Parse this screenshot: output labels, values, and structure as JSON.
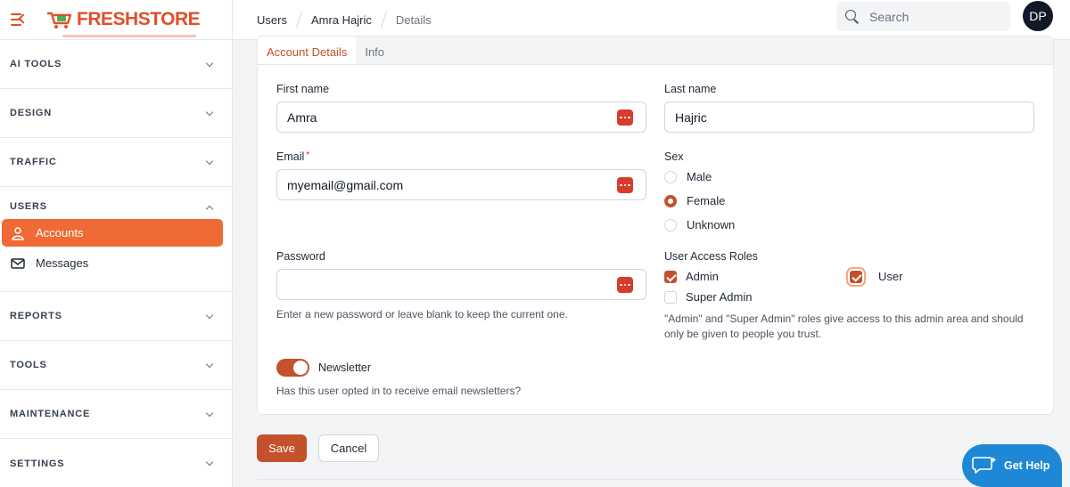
{
  "brand": {
    "name_part1": "FRESH",
    "name_part2": "STORE",
    "color": "#e0502a"
  },
  "sidebar": {
    "sections_top": [
      {
        "label": "AI TOOLS"
      },
      {
        "label": "DESIGN"
      },
      {
        "label": "TRAFFIC"
      }
    ],
    "users": {
      "label": "USERS",
      "items": [
        {
          "label": "Accounts",
          "icon": "users-icon",
          "active": true
        },
        {
          "label": "Messages",
          "icon": "envelope-icon",
          "active": false
        }
      ]
    },
    "sections_bottom": [
      {
        "label": "REPORTS"
      },
      {
        "label": "TOOLS"
      },
      {
        "label": "MAINTENANCE"
      },
      {
        "label": "SETTINGS"
      }
    ]
  },
  "breadcrumb": [
    "Users",
    "Amra Hajric",
    "Details"
  ],
  "search": {
    "placeholder": "Search"
  },
  "avatar": {
    "initials": "DP"
  },
  "tabs": [
    {
      "label": "Account Details",
      "active": true
    },
    {
      "label": "Info",
      "active": false
    }
  ],
  "form": {
    "first_name": {
      "label": "First name",
      "value": "Amra"
    },
    "last_name": {
      "label": "Last name",
      "value": "Hajric"
    },
    "email": {
      "label": "Email",
      "required_mark": "*",
      "value": "myemail@gmail.com"
    },
    "sex": {
      "label": "Sex",
      "options": [
        "Male",
        "Female",
        "Unknown"
      ],
      "selected": "Female"
    },
    "password": {
      "label": "Password",
      "value": "",
      "help": "Enter a new password or leave blank to keep the current one."
    },
    "roles": {
      "label": "User Access Roles",
      "options": [
        {
          "label": "Admin",
          "checked": true
        },
        {
          "label": "User",
          "checked": true
        },
        {
          "label": "Super Admin",
          "checked": false
        }
      ],
      "help": "\"Admin\" and \"Super Admin\" roles give access to this admin area and should only be given to people you trust."
    },
    "newsletter": {
      "label": "Newsletter",
      "on": true,
      "help": "Has this user opted in to receive email newsletters?"
    }
  },
  "actions": {
    "save_label": "Save",
    "cancel_label": "Cancel"
  },
  "help_widget": {
    "label": "Get Help",
    "color": "#1e88d6"
  },
  "colors": {
    "accent": "#c4512b",
    "nav_active": "#ef6a34",
    "password_icon": "#d93b2b"
  }
}
